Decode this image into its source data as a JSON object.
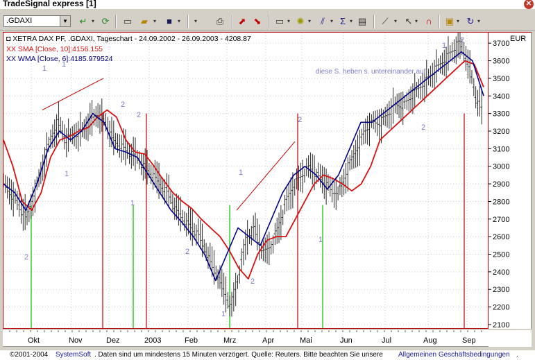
{
  "app": {
    "title": "TradeSignal express [1]"
  },
  "toolbar": {
    "symbol_value": ".GDAXI",
    "icons": [
      "go-icon",
      "refresh-icon",
      "new-icon",
      "open-icon",
      "save-icon",
      "print-icon",
      "chart-type-icon",
      "indicator-icon",
      "drawing-icon",
      "sum-icon",
      "properties-icon",
      "line-tool-icon",
      "cursor-icon",
      "magnet-icon",
      "notes-icon",
      "redo-icon"
    ]
  },
  "chart": {
    "header": "XETRA DAX PF, .GDAXI, Tageschart - 24.09.2002 - 26.09.2003 - 4208.87",
    "sma_label": "XX SMA [Close, 10]:4156.155",
    "wma_label": "XX WMA [Close, 6]:4185.979524",
    "annotation": "diese S. heben s. untereinander auf",
    "currency": "EUR",
    "colors": {
      "price": "#1a1a7a",
      "sma": "#d81010",
      "wma": "#00008b",
      "green_line": "#22cc22",
      "red_line": "#c00000",
      "count_label": "#7d7dc8"
    },
    "count_labels": [
      "1",
      "1",
      "2",
      "1",
      "2",
      "2",
      "1",
      "2",
      "1",
      "2",
      "1",
      "2",
      "1",
      "2",
      "1",
      "2"
    ]
  },
  "chart_data": {
    "type": "line",
    "title": "XETRA DAX PF, .GDAXI, Tageschart - 24.09.2002 - 26.09.2003 - 4208.87",
    "y_ticks": [
      2100,
      2200,
      2300,
      2400,
      2500,
      2600,
      2700,
      2800,
      2900,
      3000,
      3100,
      3200,
      3300,
      3400,
      3500,
      3600,
      3700
    ],
    "ylim": [
      2080,
      3760
    ],
    "x_ticks": [
      "Okt",
      "Nov",
      "Dez",
      "2003",
      "Feb",
      "Mrz",
      "Apr",
      "Mai",
      "Jun",
      "Jul",
      "Aug",
      "Sep"
    ],
    "series": [
      {
        "name": "XETRA DAX PF",
        "values": [
          2900,
          2850,
          2780,
          2700,
          2850,
          3000,
          3150,
          3250,
          3150,
          3180,
          3200,
          3250,
          3300,
          3250,
          3150,
          3120,
          3080,
          3050,
          3000,
          2950,
          2900,
          2850,
          2750,
          2700,
          2650,
          2600,
          2500,
          2400,
          2300,
          2200,
          2400,
          2600,
          2650,
          2500,
          2550,
          2650,
          2800,
          2900,
          2950,
          3000,
          2950,
          2900,
          2850,
          2880,
          3000,
          3100,
          3200,
          3250,
          3250,
          3300,
          3350,
          3350,
          3400,
          3450,
          3500,
          3550,
          3600,
          3650,
          3700,
          3600,
          3400,
          3300
        ]
      },
      {
        "name": "XX SMA [Close, 10]",
        "values": [
          3150,
          3000,
          2800,
          2750,
          2850,
          3050,
          3150,
          3170,
          3200,
          3220,
          3280,
          3320,
          3280,
          3150,
          3080,
          3070,
          3000,
          2920,
          2850,
          2800,
          2760,
          2700,
          2650,
          2600,
          2520,
          2420,
          2360,
          2500,
          2580,
          2600,
          2600,
          2700,
          2800,
          2900,
          2950,
          2930,
          2900,
          2860,
          2900,
          3000,
          3150,
          3200,
          3250,
          3300,
          3350,
          3400,
          3450,
          3500,
          3550,
          3600,
          3580,
          3450
        ]
      },
      {
        "name": "XX WMA [Close, 6]",
        "values": [
          2900,
          2850,
          2750,
          2900,
          3100,
          3200,
          3150,
          3200,
          3300,
          3250,
          3100,
          3080,
          3050,
          2950,
          2850,
          2750,
          2680,
          2600,
          2500,
          2350,
          2500,
          2650,
          2600,
          2550,
          2700,
          2850,
          2950,
          3000,
          2950,
          2870,
          2950,
          3100,
          3250,
          3250,
          3300,
          3350,
          3400,
          3450,
          3500,
          3550,
          3600,
          3650,
          3600,
          3400
        ]
      }
    ],
    "grid": true,
    "legend": "top-left"
  },
  "footer": {
    "copyright": "©2001-2004",
    "company": "SystemSoft",
    "text": ". Daten sind um mindestens 15 Minuten verzögert. Quelle: Reuters. Bitte beachten Sie unsere",
    "terms_link": "Allgemeinen Geschäftsbedingungen",
    "end": "."
  }
}
